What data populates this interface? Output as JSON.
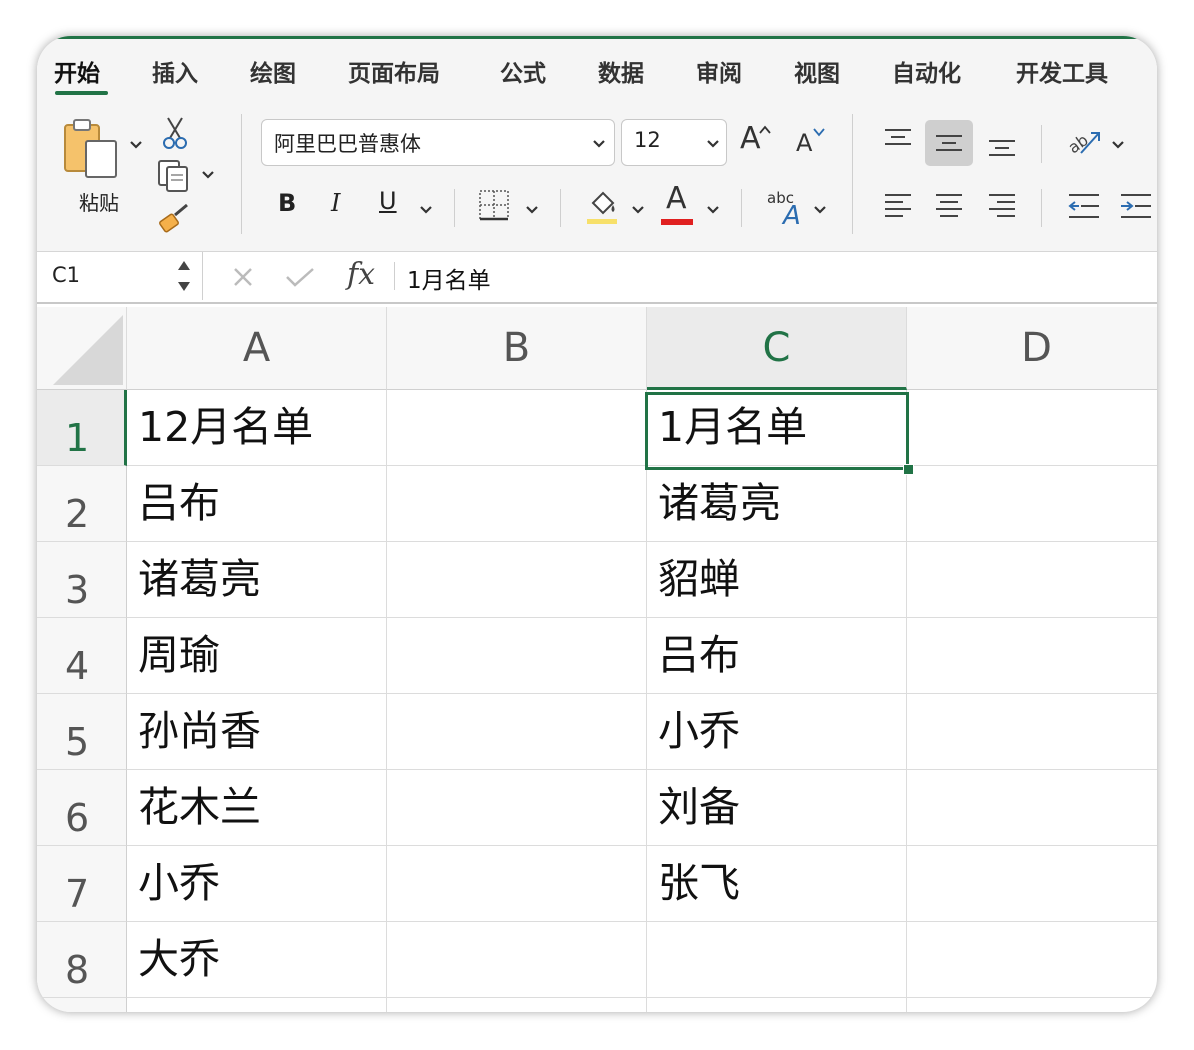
{
  "ribbon": {
    "tabs": [
      "开始",
      "插入",
      "绘图",
      "页面布局",
      "公式",
      "数据",
      "审阅",
      "视图",
      "自动化",
      "开发工具"
    ],
    "active_tab": "开始",
    "paste_label": "粘贴",
    "font_name": "阿里巴巴普惠体",
    "font_size": "12",
    "bold_label": "B",
    "italic_label": "I",
    "underline_label": "U",
    "font_color_letter": "A",
    "grow_font_letter": "A",
    "shrink_font_letter": "A",
    "orientation_abc": "abc",
    "orientation_letter": "A",
    "accent_color": "#217346",
    "font_color": "#e02020"
  },
  "formula_bar": {
    "name_box": "C1",
    "fx_label": "fx",
    "content": "1月名单"
  },
  "sheet": {
    "columns": [
      "A",
      "B",
      "C",
      "D"
    ],
    "selected_column": "C",
    "rows": [
      {
        "num": "1",
        "A": "12月名单",
        "B": "",
        "C": "1月名单",
        "D": ""
      },
      {
        "num": "2",
        "A": "吕布",
        "B": "",
        "C": "诸葛亮",
        "D": ""
      },
      {
        "num": "3",
        "A": "诸葛亮",
        "B": "",
        "C": "貂蝉",
        "D": ""
      },
      {
        "num": "4",
        "A": "周瑜",
        "B": "",
        "C": "吕布",
        "D": ""
      },
      {
        "num": "5",
        "A": "孙尚香",
        "B": "",
        "C": "小乔",
        "D": ""
      },
      {
        "num": "6",
        "A": "花木兰",
        "B": "",
        "C": "刘备",
        "D": ""
      },
      {
        "num": "7",
        "A": "小乔",
        "B": "",
        "C": "张飞",
        "D": ""
      },
      {
        "num": "8",
        "A": "大乔",
        "B": "",
        "C": "",
        "D": ""
      }
    ],
    "active_cell": "C1"
  }
}
